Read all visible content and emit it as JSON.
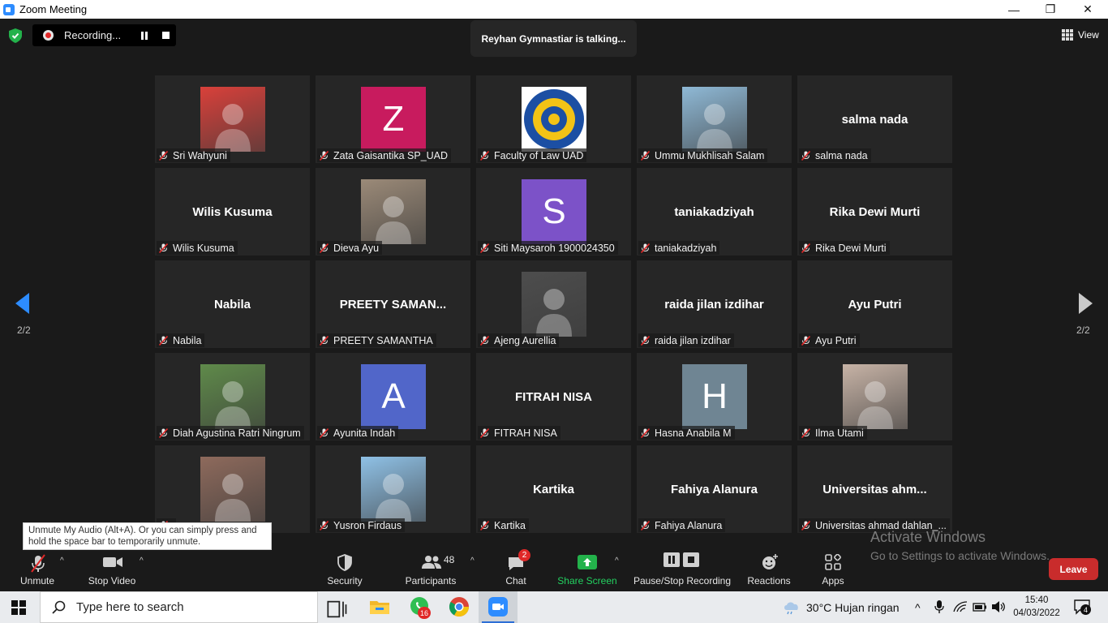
{
  "window": {
    "title": "Zoom Meeting",
    "minimize": "—",
    "maximize": "❐",
    "close": "✕"
  },
  "topbar": {
    "recording_label": "Recording...",
    "talking": "Reyhan Gymnastiar is talking...",
    "view_label": "View"
  },
  "gallery": {
    "page_left": "2/2",
    "page_right": "2/2",
    "tiles": [
      {
        "name": "Sri Wahyuni",
        "kind": "photo",
        "color": "#d9403a"
      },
      {
        "name": "Zata Gaisantika SP_UAD",
        "kind": "letter",
        "letter": "Z",
        "color": "#c81b5e"
      },
      {
        "name": "Faculty of Law UAD",
        "kind": "logo",
        "color": "#f5f5f5"
      },
      {
        "name": "Ummu Mukhlisah Salam",
        "kind": "photo",
        "color": "#8fb9d6"
      },
      {
        "name": "salma nada",
        "kind": "text",
        "display": "salma nada"
      },
      {
        "name": "Wilis Kusuma",
        "kind": "text",
        "display": "Wilis Kusuma"
      },
      {
        "name": "Dieva Ayu",
        "kind": "photo",
        "color": "#9b8a78"
      },
      {
        "name": "Siti Maysaroh 1900024350",
        "kind": "letter",
        "letter": "S",
        "color": "#7c52c8"
      },
      {
        "name": "taniakadziyah",
        "kind": "text",
        "display": "taniakadziyah"
      },
      {
        "name": "Rika Dewi Murti",
        "kind": "text",
        "display": "Rika Dewi Murti"
      },
      {
        "name": "Nabila",
        "kind": "text",
        "display": "Nabila"
      },
      {
        "name": "PREETY SAMANTHA",
        "kind": "text",
        "display": "PREETY  SAMAN..."
      },
      {
        "name": "Ajeng Aurellia",
        "kind": "photo",
        "color": "#4d4d4d"
      },
      {
        "name": "raida jilan izdihar",
        "kind": "text",
        "display": "raida jilan izdihar"
      },
      {
        "name": "Ayu Putri",
        "kind": "text",
        "display": "Ayu Putri"
      },
      {
        "name": "Diah Agustina Ratri Ningrum",
        "kind": "photo",
        "color": "#5f8a4a"
      },
      {
        "name": "Ayunita Indah",
        "kind": "letter",
        "letter": "A",
        "color": "#5166c9"
      },
      {
        "name": "FITRAH NISA",
        "kind": "text",
        "display": "FITRAH NISA"
      },
      {
        "name": "Hasna Anabila M",
        "kind": "letter",
        "letter": "H",
        "color": "#6f8593"
      },
      {
        "name": "Ilma Utami",
        "kind": "photo",
        "color": "#c7b3a6"
      },
      {
        "name": "",
        "kind": "photo",
        "color": "#8e6a5c"
      },
      {
        "name": "Yusron Firdaus",
        "kind": "photo",
        "color": "#8fc1e6"
      },
      {
        "name": "Kartika",
        "kind": "text",
        "display": "Kartika"
      },
      {
        "name": "Fahiya Alanura",
        "kind": "text",
        "display": "Fahiya Alanura"
      },
      {
        "name": "Universitas ahmad dahlan_...",
        "kind": "text",
        "display": "Universitas  ahm..."
      }
    ]
  },
  "tooltip": "Unmute My Audio (Alt+A). Or you can simply press and hold the space bar to temporarily unmute.",
  "toolbar": {
    "unmute": "Unmute",
    "stop_video": "Stop Video",
    "security": "Security",
    "participants": "Participants",
    "participants_count": "48",
    "chat": "Chat",
    "chat_badge": "2",
    "share_screen": "Share Screen",
    "pause_stop_recording": "Pause/Stop Recording",
    "reactions": "Reactions",
    "apps": "Apps",
    "leave": "Leave"
  },
  "watermark": {
    "line1": "Activate Windows",
    "line2": "Go to Settings to activate Windows."
  },
  "taskbar": {
    "search_placeholder": "Type here to search",
    "whatsapp_badge": "16",
    "weather": "30°C  Hujan ringan",
    "time": "15:40",
    "date": "04/03/2022",
    "notifications": "4"
  }
}
